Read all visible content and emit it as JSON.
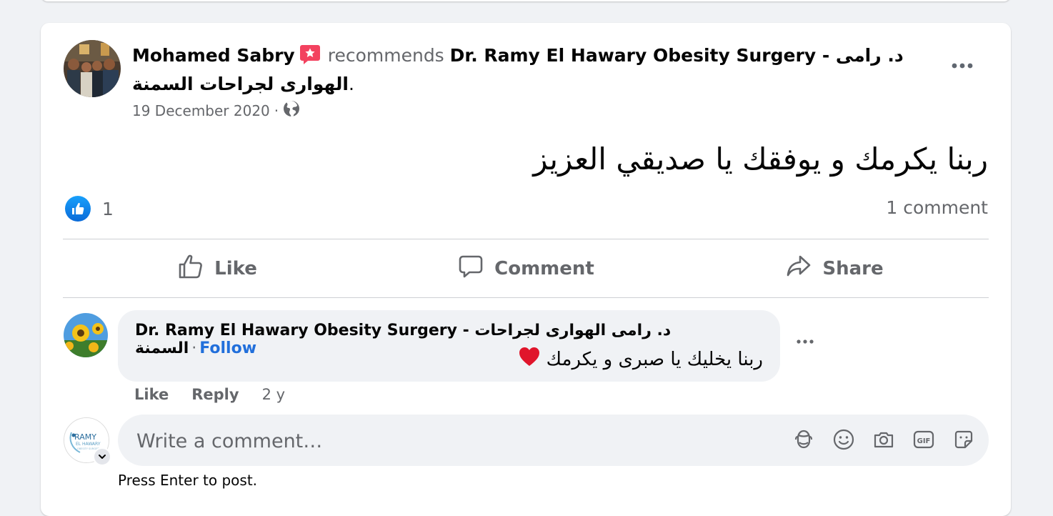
{
  "post": {
    "author": "Mohamed Sabry",
    "verb": "recommends",
    "page_name": "Dr. Ramy El Hawary Obesity Surgery - د. رامى الهوارى لجراحات السمنة",
    "page_suffix": ".",
    "date": "19 December 2020",
    "separator": "·",
    "audience_icon": "globe-icon",
    "body": "ربنا يكرمك و يوفقك يا صديقي العزيز",
    "like_count": "1",
    "comment_count": "1 comment",
    "more_icon": "more-horizontal-icon"
  },
  "actions": {
    "like": "Like",
    "comment": "Comment",
    "share": "Share"
  },
  "comment": {
    "author": "Dr. Ramy El Hawary Obesity Surgery - د. رامى الهوارى لجراحات السمنة",
    "separator": "·",
    "follow": "Follow",
    "text": "ربنا يخليك يا صبرى و يكرمك",
    "like": "Like",
    "reply": "Reply",
    "age": "2 y"
  },
  "composer": {
    "placeholder": "Write a comment…",
    "hint": "Press Enter to post.",
    "icons": [
      "avatar-sticker-icon",
      "emoji-icon",
      "camera-icon",
      "gif-icon",
      "sticker-icon"
    ]
  },
  "colors": {
    "link_blue": "#216fdb",
    "secondary_text": "#65676b",
    "like_blue": "#1877f2",
    "badge_red": "#f3425f"
  }
}
